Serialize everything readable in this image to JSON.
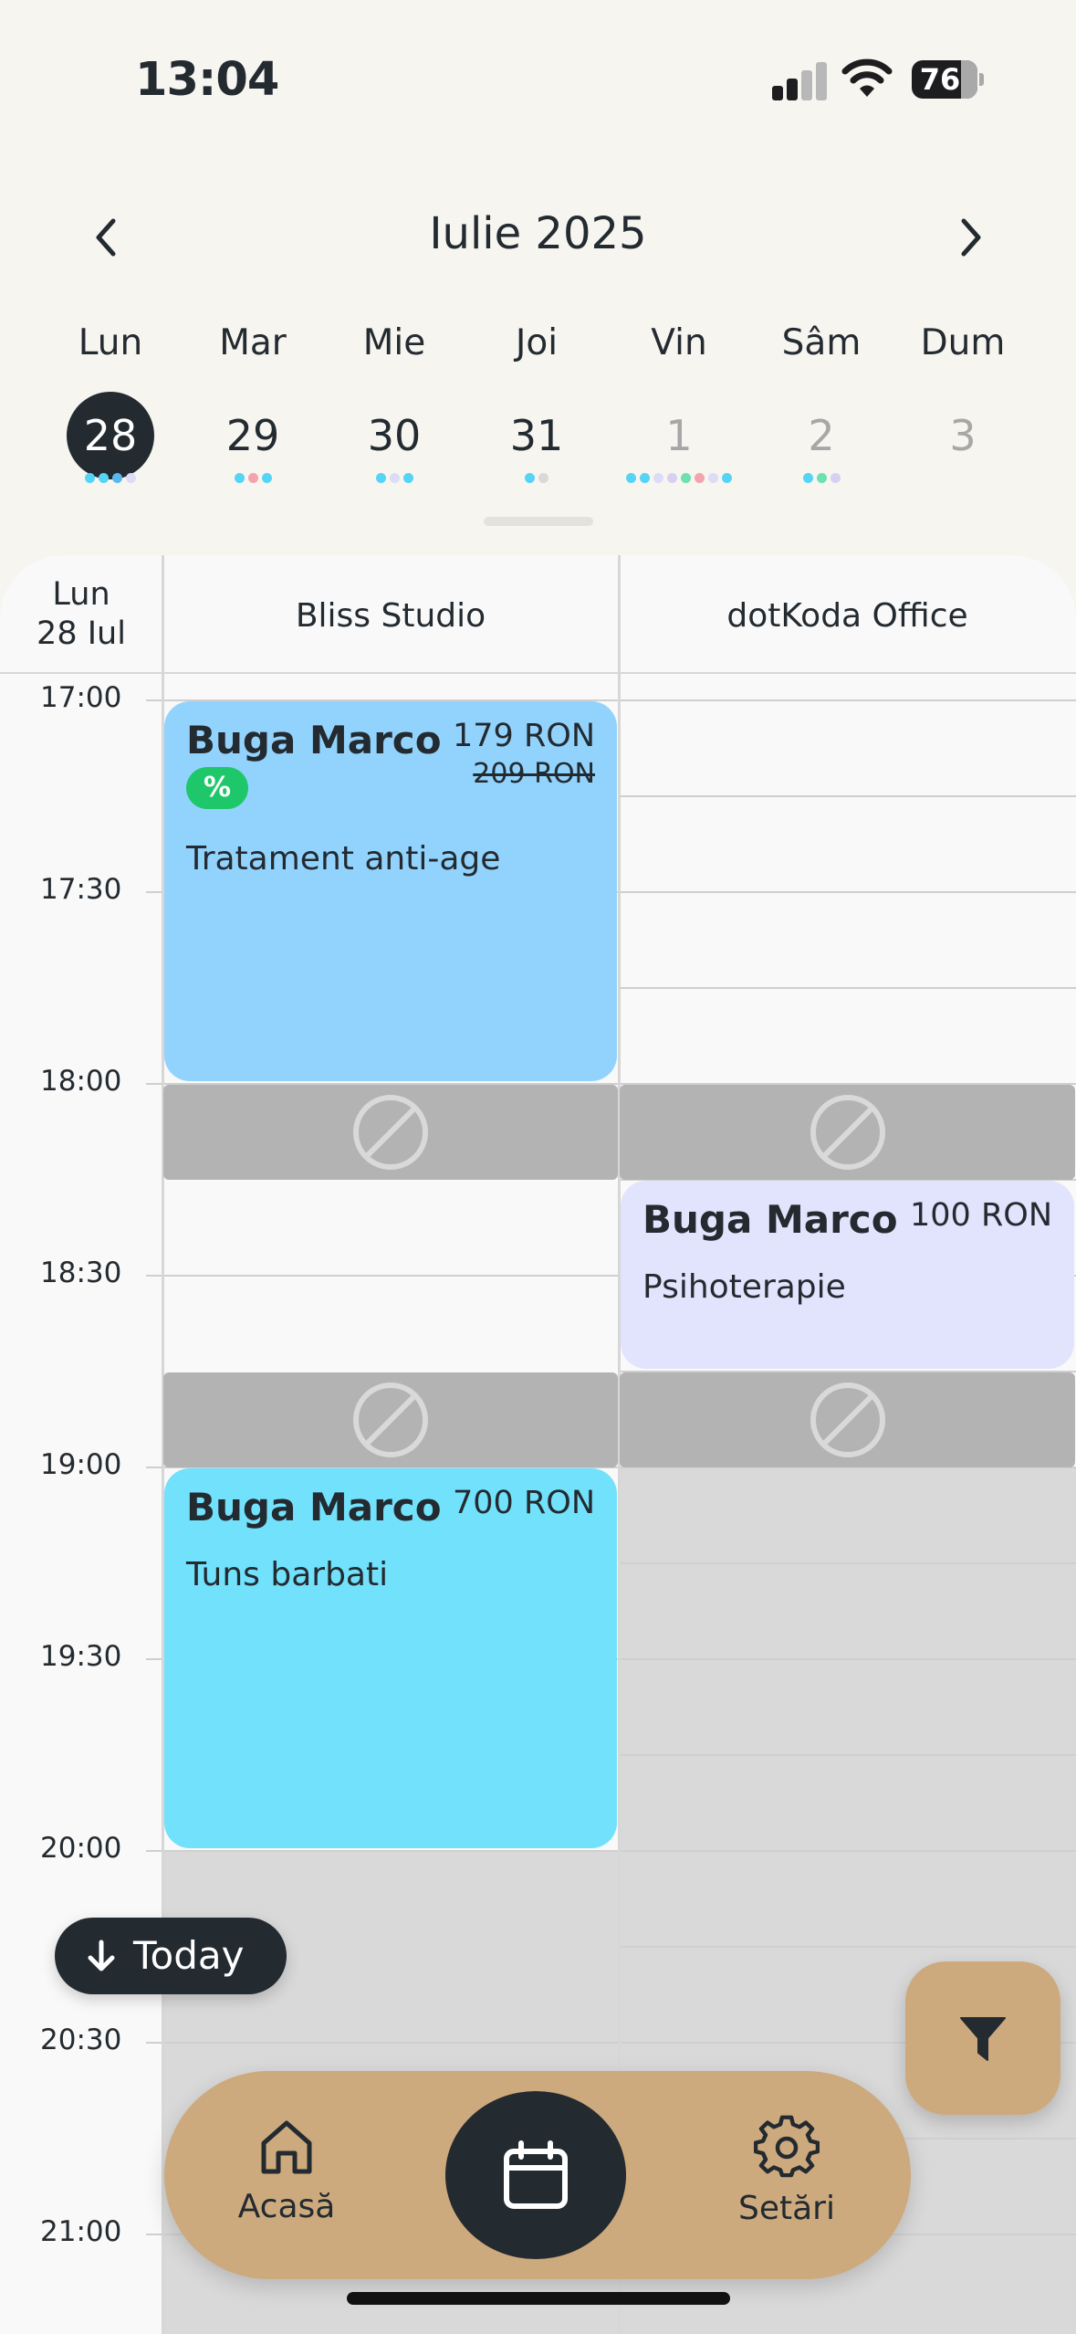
{
  "status_bar": {
    "time": "13:04",
    "battery": "76"
  },
  "calendar_header": {
    "month_title": "Iulie 2025",
    "prev_icon": "chevron-left-icon",
    "next_icon": "chevron-right-icon"
  },
  "week": [
    {
      "name": "Lun",
      "num": "28",
      "state": "selected",
      "dots": [
        "#55d4f5",
        "#55d4f5",
        "#5ab8f0",
        "#dcdcf7"
      ]
    },
    {
      "name": "Mar",
      "num": "29",
      "state": "normal",
      "dots": [
        "#55d4f5",
        "#f2a4ae",
        "#55d4f5"
      ]
    },
    {
      "name": "Mie",
      "num": "30",
      "state": "normal",
      "dots": [
        "#55d4f5",
        "#dcdcf7",
        "#55d4f5"
      ]
    },
    {
      "name": "Joi",
      "num": "31",
      "state": "normal",
      "dots": [
        "#55d4f5",
        "#d9d9d9"
      ]
    },
    {
      "name": "Vin",
      "num": "1",
      "state": "faded",
      "dots": [
        "#55d4f5",
        "#55d4f5",
        "#dcdcf7",
        "#d8d0f2",
        "#6ee0b0",
        "#f2a4ae",
        "#dcdcf7",
        "#55d4f5"
      ]
    },
    {
      "name": "Sâm",
      "num": "2",
      "state": "faded",
      "dots": [
        "#55d4f5",
        "#6ee0b0",
        "#d8d0f2"
      ]
    },
    {
      "name": "Dum",
      "num": "3",
      "state": "faded",
      "dots": []
    }
  ],
  "schedule": {
    "day_label": "Lun",
    "date_label": "28 Iul",
    "columns": [
      "Bliss Studio",
      "dotKoda Office"
    ],
    "times": [
      "17:00",
      "17:30",
      "18:00",
      "18:30",
      "19:00",
      "19:30",
      "20:00",
      "20:30",
      "21:00"
    ],
    "events": [
      {
        "name": "Buga Marco",
        "price": "179 RON",
        "old_price": "209 RON",
        "badge": "%",
        "service": "Tratament anti-age",
        "color": "#92d3fd"
      },
      {
        "name": "Buga Marco",
        "price": "100 RON",
        "service": "Psihoterapie",
        "color": "#e1e4fc"
      },
      {
        "name": "Buga Marco",
        "price": "700 RON",
        "service": "Tuns barbati",
        "color": "#72e1fb"
      }
    ],
    "blocked_icon": "blocked-icon"
  },
  "today_button": {
    "label": "Today",
    "icon": "arrow-down-icon"
  },
  "filter_button": {
    "icon": "filter-icon"
  },
  "bottom_nav": {
    "items": [
      {
        "label": "Acasă",
        "icon": "home-icon"
      },
      {
        "label": "",
        "icon": "calendar-icon"
      },
      {
        "label": "Setări",
        "icon": "gear-icon"
      }
    ]
  },
  "colors": {
    "dark": "#232a30",
    "accent_tan": "#cdaa7d",
    "blocked_gray": "#b3b3b3",
    "closed_gray": "#d9d9d9",
    "discount_green": "#1ec86a"
  }
}
